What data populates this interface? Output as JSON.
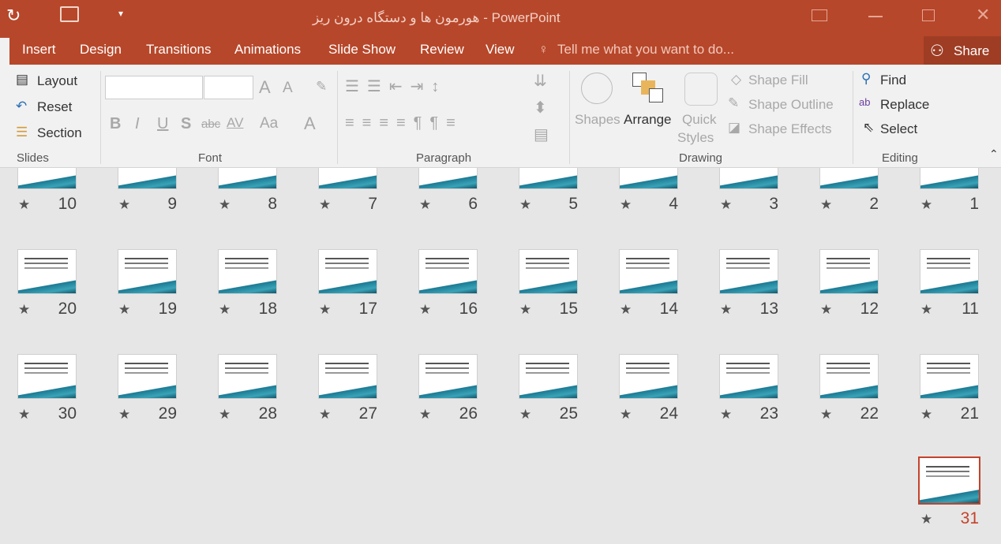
{
  "title": "هورمون ها و دستگاه درون ریز - PowerPoint",
  "quick_access": {
    "undo_icon": "redo-icon",
    "present_icon": "present-from-start-icon",
    "customize_icon": "customize-qat-icon"
  },
  "window_controls": [
    "ribbon-display-icon",
    "minimize-icon",
    "maximize-icon",
    "close-icon"
  ],
  "tabs": [
    "Insert",
    "Design",
    "Transitions",
    "Animations",
    "Slide Show",
    "Review",
    "View"
  ],
  "tell_me": "Tell me what you want to do...",
  "share": "Share",
  "slides_group": {
    "label": "Slides",
    "layout": "Layout",
    "reset": "Reset",
    "section": "Section"
  },
  "font_group": {
    "label": "Font",
    "bold": "B",
    "italic": "I",
    "underline": "U",
    "shadow": "S",
    "strike": "abc",
    "spacing": "AV",
    "case": "Aa",
    "color": "A"
  },
  "paragraph_group": {
    "label": "Paragraph"
  },
  "drawing_group": {
    "label": "Drawing",
    "shapes": "Shapes",
    "arrange": "Arrange",
    "quick": "Quick",
    "styles": "Styles",
    "fill": "Shape Fill",
    "outline": "Shape Outline",
    "effects": "Shape Effects"
  },
  "editing_group": {
    "label": "Editing",
    "find": "Find",
    "replace": "Replace",
    "select": "Select"
  },
  "slides": [
    "1",
    "2",
    "3",
    "4",
    "5",
    "6",
    "7",
    "8",
    "9",
    "10",
    "11",
    "12",
    "13",
    "14",
    "15",
    "16",
    "17",
    "18",
    "19",
    "20",
    "21",
    "22",
    "23",
    "24",
    "25",
    "26",
    "27",
    "28",
    "29",
    "30",
    "31"
  ],
  "selected_slide": "31",
  "star": "★",
  "colors": {
    "accent": "#b7472a",
    "selected": "#c5422a"
  }
}
